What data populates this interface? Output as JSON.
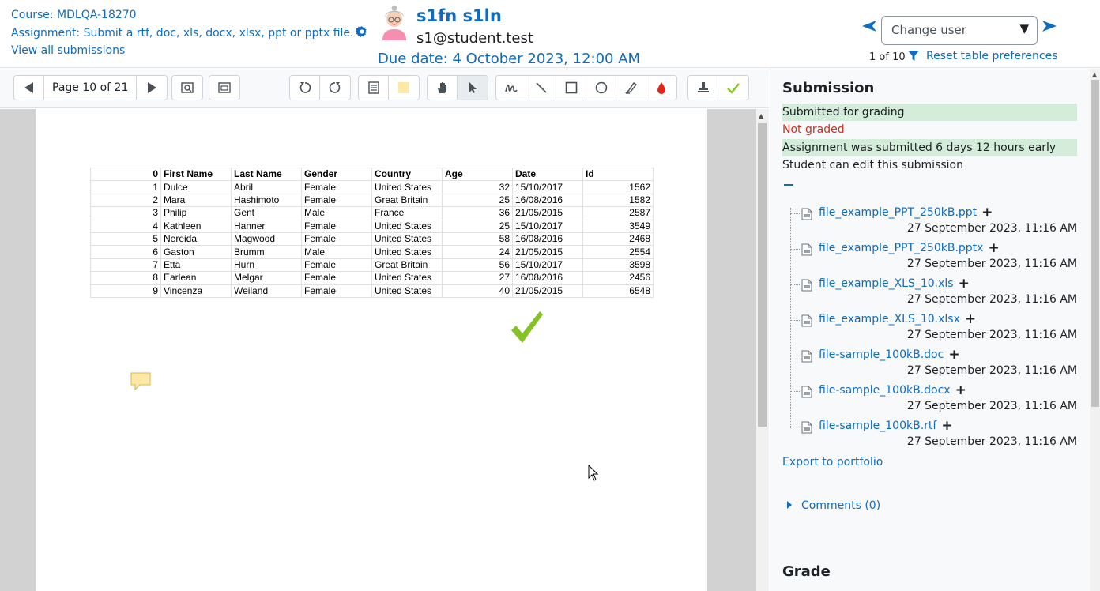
{
  "header": {
    "course": "Course: MDLQA-18270",
    "assignment": "Assignment: Submit a rtf, doc, xls, docx, xlsx, ppt or pptx file.",
    "view_all": "View all submissions",
    "user_name": "s1fn s1ln",
    "user_email": "s1@student.test",
    "due_date": "Due date: 4 October 2023, 12:00 AM",
    "change_user": "Change user",
    "counter": "1 of 10",
    "reset_prefs": "Reset table preferences"
  },
  "toolbar": {
    "page_label": "Page 10 of 21"
  },
  "sheet": {
    "headers": [
      "0",
      "First Name",
      "Last Name",
      "Gender",
      "Country",
      "Age",
      "Date",
      "Id"
    ],
    "rows": [
      [
        "1",
        "Dulce",
        "Abril",
        "Female",
        "United States",
        "32",
        "15/10/2017",
        "1562"
      ],
      [
        "2",
        "Mara",
        "Hashimoto",
        "Female",
        "Great Britain",
        "25",
        "16/08/2016",
        "1582"
      ],
      [
        "3",
        "Philip",
        "Gent",
        "Male",
        "France",
        "36",
        "21/05/2015",
        "2587"
      ],
      [
        "4",
        "Kathleen",
        "Hanner",
        "Female",
        "United States",
        "25",
        "15/10/2017",
        "3549"
      ],
      [
        "5",
        "Nereida",
        "Magwood",
        "Female",
        "United States",
        "58",
        "16/08/2016",
        "2468"
      ],
      [
        "6",
        "Gaston",
        "Brumm",
        "Male",
        "United States",
        "24",
        "21/05/2015",
        "2554"
      ],
      [
        "7",
        "Etta",
        "Hurn",
        "Female",
        "Great Britain",
        "56",
        "15/10/2017",
        "3598"
      ],
      [
        "8",
        "Earlean",
        "Melgar",
        "Female",
        "United States",
        "27",
        "16/08/2016",
        "2456"
      ],
      [
        "9",
        "Vincenza",
        "Weiland",
        "Female",
        "United States",
        "40",
        "21/05/2015",
        "6548"
      ]
    ]
  },
  "panel": {
    "submission_title": "Submission",
    "status_submitted": "Submitted for grading",
    "status_graded": "Not graded",
    "status_early": "Assignment was submitted 6 days 12 hours early",
    "status_edit": "Student can edit this submission",
    "files": [
      {
        "name": "file_example_PPT_250kB.ppt",
        "date": "27 September 2023, 11:16 AM"
      },
      {
        "name": "file_example_PPT_250kB.pptx",
        "date": "27 September 2023, 11:16 AM"
      },
      {
        "name": "file_example_XLS_10.xls",
        "date": "27 September 2023, 11:16 AM"
      },
      {
        "name": "file_example_XLS_10.xlsx",
        "date": "27 September 2023, 11:16 AM"
      },
      {
        "name": "file-sample_100kB.doc",
        "date": "27 September 2023, 11:16 AM"
      },
      {
        "name": "file-sample_100kB.docx",
        "date": "27 September 2023, 11:16 AM"
      },
      {
        "name": "file-sample_100kB.rtf",
        "date": "27 September 2023, 11:16 AM"
      }
    ],
    "export": "Export to portfolio",
    "comments": "Comments (0)",
    "grade_title": "Grade"
  },
  "colors": {
    "link": "#0f6cbf",
    "status_green_bg": "#d4edda",
    "status_red": "#ca3120",
    "annotation_yellow": "#fde9a5",
    "stamp_green": "#84c225"
  },
  "icons": {
    "gear": "gear-icon",
    "filter": "filter-icon",
    "prev_user": "left-arrow-icon",
    "next_user": "right-arrow-icon"
  }
}
